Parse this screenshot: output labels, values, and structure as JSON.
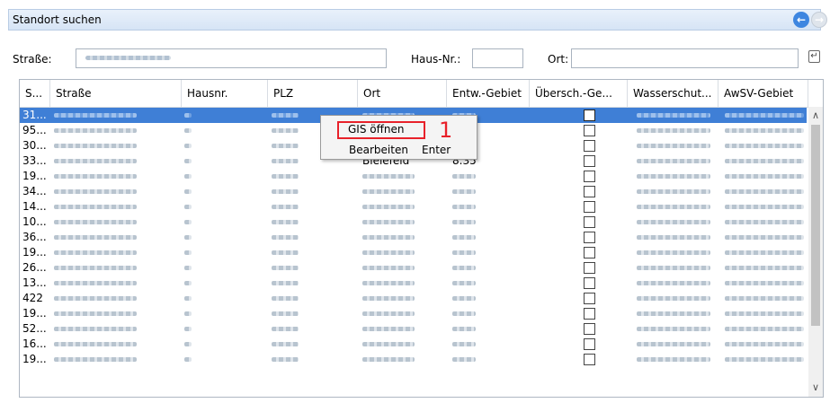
{
  "window": {
    "title": "Standort suchen"
  },
  "filters": {
    "strasse_label": "Straße:",
    "hausnr_label": "Haus-Nr.:",
    "ort_label": "Ort:"
  },
  "table": {
    "columns": [
      "S...",
      "Straße",
      "Hausnr.",
      "PLZ",
      "Ort",
      "Entw.-Gebiet",
      "Übersch.-Ge...",
      "Wasserschut...",
      "AwSV-Gebiet"
    ],
    "rows": [
      {
        "s": "31...",
        "selected": true
      },
      {
        "s": "95..."
      },
      {
        "s": "30..."
      },
      {
        "s": "33...",
        "ort": "Bielefeld",
        "entw": "8.35"
      },
      {
        "s": "19..."
      },
      {
        "s": "34..."
      },
      {
        "s": "14..."
      },
      {
        "s": "10..."
      },
      {
        "s": "36..."
      },
      {
        "s": "19..."
      },
      {
        "s": "26..."
      },
      {
        "s": "13..."
      },
      {
        "s": "422"
      },
      {
        "s": "19..."
      },
      {
        "s": "52..."
      },
      {
        "s": "16..."
      },
      {
        "s": "19..."
      }
    ]
  },
  "context_menu": {
    "items": [
      {
        "label": "GIS öffnen",
        "shortcut": ""
      },
      {
        "label": "Bearbeiten",
        "shortcut": "Enter"
      }
    ],
    "annotation": "1"
  },
  "icons": {
    "back": "arrow-left-icon",
    "forward": "arrow-right-icon",
    "corner": "enter-key-icon",
    "scroll_up": "chevron-up-icon",
    "scroll_down": "chevron-down-icon"
  },
  "colors": {
    "selection": "#3f7fd6",
    "annotation": "#e8212a",
    "title_bg": "#dbe7f6"
  }
}
